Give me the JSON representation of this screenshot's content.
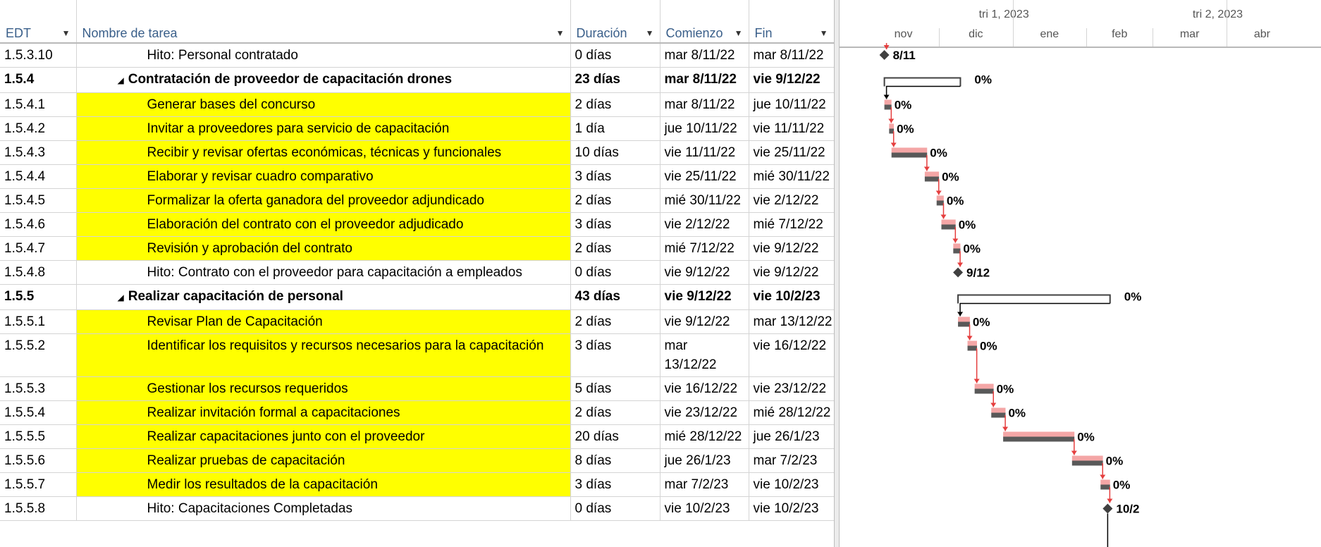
{
  "columns": {
    "edt": "EDT",
    "name": "Nombre de tarea",
    "duration": "Duración",
    "start": "Comienzo",
    "finish": "Fin"
  },
  "timescale": {
    "quarters": [
      "tri 1, 2023",
      "tri 2, 2023"
    ],
    "months": [
      "nov",
      "dic",
      "ene",
      "feb",
      "mar",
      "abr"
    ]
  },
  "tasks": [
    {
      "edt": "1.5.3.10",
      "name": "Hito: Personal contratado",
      "duration": "0 días",
      "start": "mar 8/11/22",
      "finish": "mar 8/11/22",
      "summary": false,
      "highlight": false,
      "milestone": true,
      "label": "8/11"
    },
    {
      "edt": "1.5.4",
      "name": "Contratación de proveedor de capacitación drones",
      "duration": "23 días",
      "start": "mar 8/11/22",
      "finish": "vie 9/12/22",
      "summary": true,
      "highlight": false,
      "label": "0%"
    },
    {
      "edt": "1.5.4.1",
      "name": "Generar bases del concurso",
      "duration": "2 días",
      "start": "mar 8/11/22",
      "finish": "jue 10/11/22",
      "summary": false,
      "highlight": true,
      "label": "0%"
    },
    {
      "edt": "1.5.4.2",
      "name": "Invitar a proveedores para servicio de capacitación",
      "duration": "1 día",
      "start": "jue 10/11/22",
      "finish": "vie 11/11/22",
      "summary": false,
      "highlight": true,
      "label": "0%"
    },
    {
      "edt": "1.5.4.3",
      "name": "Recibir y revisar ofertas económicas, técnicas y funcionales",
      "duration": "10 días",
      "start": "vie 11/11/22",
      "finish": "vie 25/11/22",
      "summary": false,
      "highlight": true,
      "label": "0%"
    },
    {
      "edt": "1.5.4.4",
      "name": "Elaborar y revisar cuadro comparativo",
      "duration": "3 días",
      "start": "vie 25/11/22",
      "finish": "mié 30/11/22",
      "summary": false,
      "highlight": true,
      "label": "0%"
    },
    {
      "edt": "1.5.4.5",
      "name": "Formalizar la oferta ganadora del proveedor adjundicado",
      "duration": "2 días",
      "start": "mié 30/11/22",
      "finish": "vie 2/12/22",
      "summary": false,
      "highlight": true,
      "label": "0%"
    },
    {
      "edt": "1.5.4.6",
      "name": "Elaboración del contrato con el proveedor adjudicado",
      "duration": "3 días",
      "start": "vie 2/12/22",
      "finish": "mié 7/12/22",
      "summary": false,
      "highlight": true,
      "label": "0%"
    },
    {
      "edt": "1.5.4.7",
      "name": "Revisión y aprobación del contrato",
      "duration": "2 días",
      "start": "mié 7/12/22",
      "finish": "vie 9/12/22",
      "summary": false,
      "highlight": true,
      "label": "0%"
    },
    {
      "edt": "1.5.4.8",
      "name": "Hito: Contrato con el proveedor para capacitación a empleados",
      "duration": "0 días",
      "start": "vie 9/12/22",
      "finish": "vie 9/12/22",
      "summary": false,
      "highlight": false,
      "milestone": true,
      "label": "9/12"
    },
    {
      "edt": "1.5.5",
      "name": "Realizar capacitación de personal",
      "duration": "43 días",
      "start": "vie 9/12/22",
      "finish": "vie 10/2/23",
      "summary": true,
      "highlight": false,
      "label": "0%"
    },
    {
      "edt": "1.5.5.1",
      "name": "Revisar Plan de Capacitación",
      "duration": "2 días",
      "start": "vie 9/12/22",
      "finish": "mar 13/12/22",
      "summary": false,
      "highlight": true,
      "label": "0%"
    },
    {
      "edt": "1.5.5.2",
      "name": "Identificar los requisitos y recursos necesarios para la capacitación",
      "duration": "3 días",
      "start": "mar 13/12/22",
      "finish": "vie 16/12/22",
      "summary": false,
      "highlight": true,
      "label": "0%"
    },
    {
      "edt": "1.5.5.3",
      "name": "Gestionar los recursos requeridos",
      "duration": "5 días",
      "start": "vie 16/12/22",
      "finish": "vie 23/12/22",
      "summary": false,
      "highlight": true,
      "label": "0%"
    },
    {
      "edt": "1.5.5.4",
      "name": "Realizar invitación formal a capacitaciones",
      "duration": "2 días",
      "start": "vie 23/12/22",
      "finish": "mié 28/12/22",
      "summary": false,
      "highlight": true,
      "label": "0%"
    },
    {
      "edt": "1.5.5.5",
      "name": "Realizar capacitaciones junto con el proveedor",
      "duration": "20 días",
      "start": "mié 28/12/22",
      "finish": "jue 26/1/23",
      "summary": false,
      "highlight": true,
      "label": "0%"
    },
    {
      "edt": "1.5.5.6",
      "name": "Realizar pruebas de capacitación",
      "duration": "8 días",
      "start": "jue 26/1/23",
      "finish": "mar 7/2/23",
      "summary": false,
      "highlight": true,
      "label": "0%"
    },
    {
      "edt": "1.5.5.7",
      "name": "Medir los resultados de la capacitación",
      "duration": "3 días",
      "start": "mar 7/2/23",
      "finish": "vie 10/2/23",
      "summary": false,
      "highlight": true,
      "label": "0%"
    },
    {
      "edt": "1.5.5.8",
      "name": "Hito: Capacitaciones Completadas",
      "duration": "0 días",
      "start": "vie 10/2/23",
      "finish": "vie 10/2/23",
      "summary": false,
      "highlight": false,
      "milestone": true,
      "label": "10/2"
    }
  ],
  "colors": {
    "highlight": "#ffff00",
    "bar_fill": "#f4a6a6",
    "bar_progress": "#595959",
    "link": "#e53e3e",
    "summary": "#404040"
  }
}
